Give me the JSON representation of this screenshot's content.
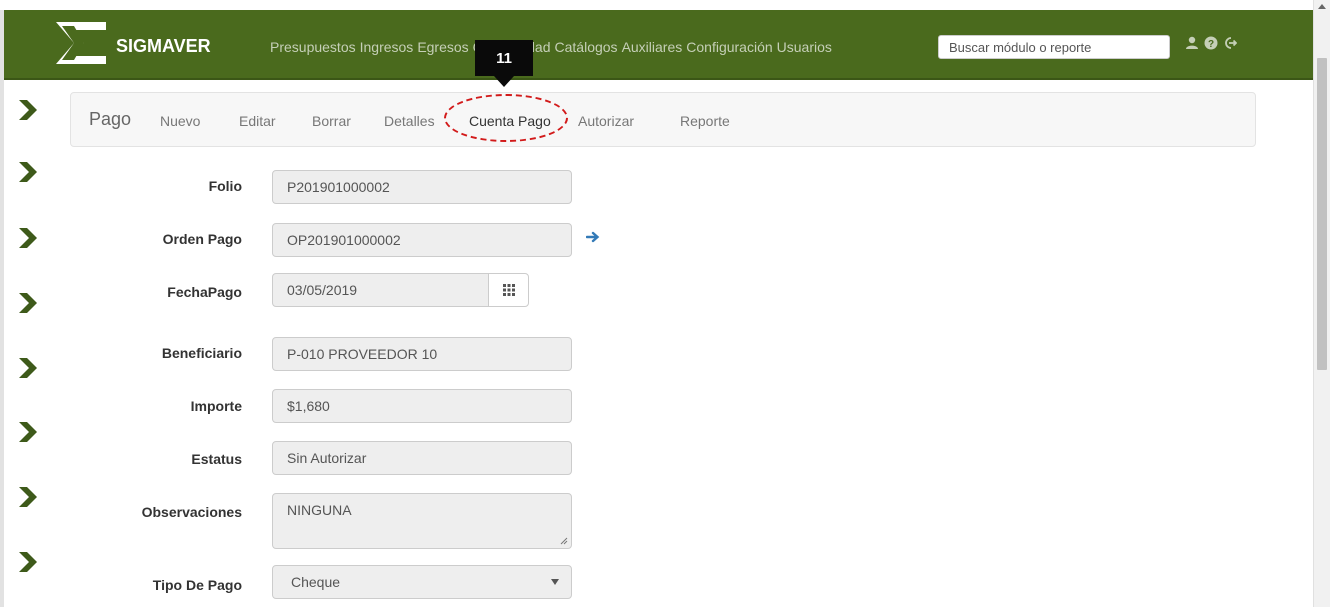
{
  "app": {
    "brand": "SIGMAVER",
    "menu": [
      "Presupuestos",
      "Ingresos",
      "Egresos",
      "Contabilidad",
      "Catálogos",
      "Auxiliares",
      "Configuración",
      "Usuarios"
    ],
    "search_placeholder": "Buscar módulo o reporte",
    "icons": [
      "user-icon",
      "help-icon",
      "logout-icon"
    ]
  },
  "callout": {
    "number": "11"
  },
  "toolbar": {
    "title": "Pago",
    "tabs": [
      "Nuevo",
      "Editar",
      "Borrar",
      "Detalles",
      "Cuenta Pago",
      "Autorizar",
      "Reporte"
    ],
    "highlighted_tab": "Cuenta Pago"
  },
  "form": {
    "folio": {
      "label": "Folio",
      "value": "P201901000002"
    },
    "orden_pago": {
      "label": "Orden Pago",
      "value": "OP201901000002"
    },
    "fecha_pago": {
      "label": "FechaPago",
      "value": "03/05/2019"
    },
    "beneficiario": {
      "label": "Beneficiario",
      "value": "P-010 PROVEEDOR 10"
    },
    "importe": {
      "label": "Importe",
      "value": "$1,680"
    },
    "estatus": {
      "label": "Estatus",
      "value": "Sin Autorizar"
    },
    "observaciones": {
      "label": "Observaciones",
      "value": "NINGUNA"
    },
    "tipo_pago": {
      "label": "Tipo De Pago",
      "value": "Cheque"
    }
  },
  "colors": {
    "navbar": "#4a6a1d",
    "chevron": "#3e5a1a",
    "highlight": "#d21a1a",
    "link_arrow": "#337ab7"
  }
}
